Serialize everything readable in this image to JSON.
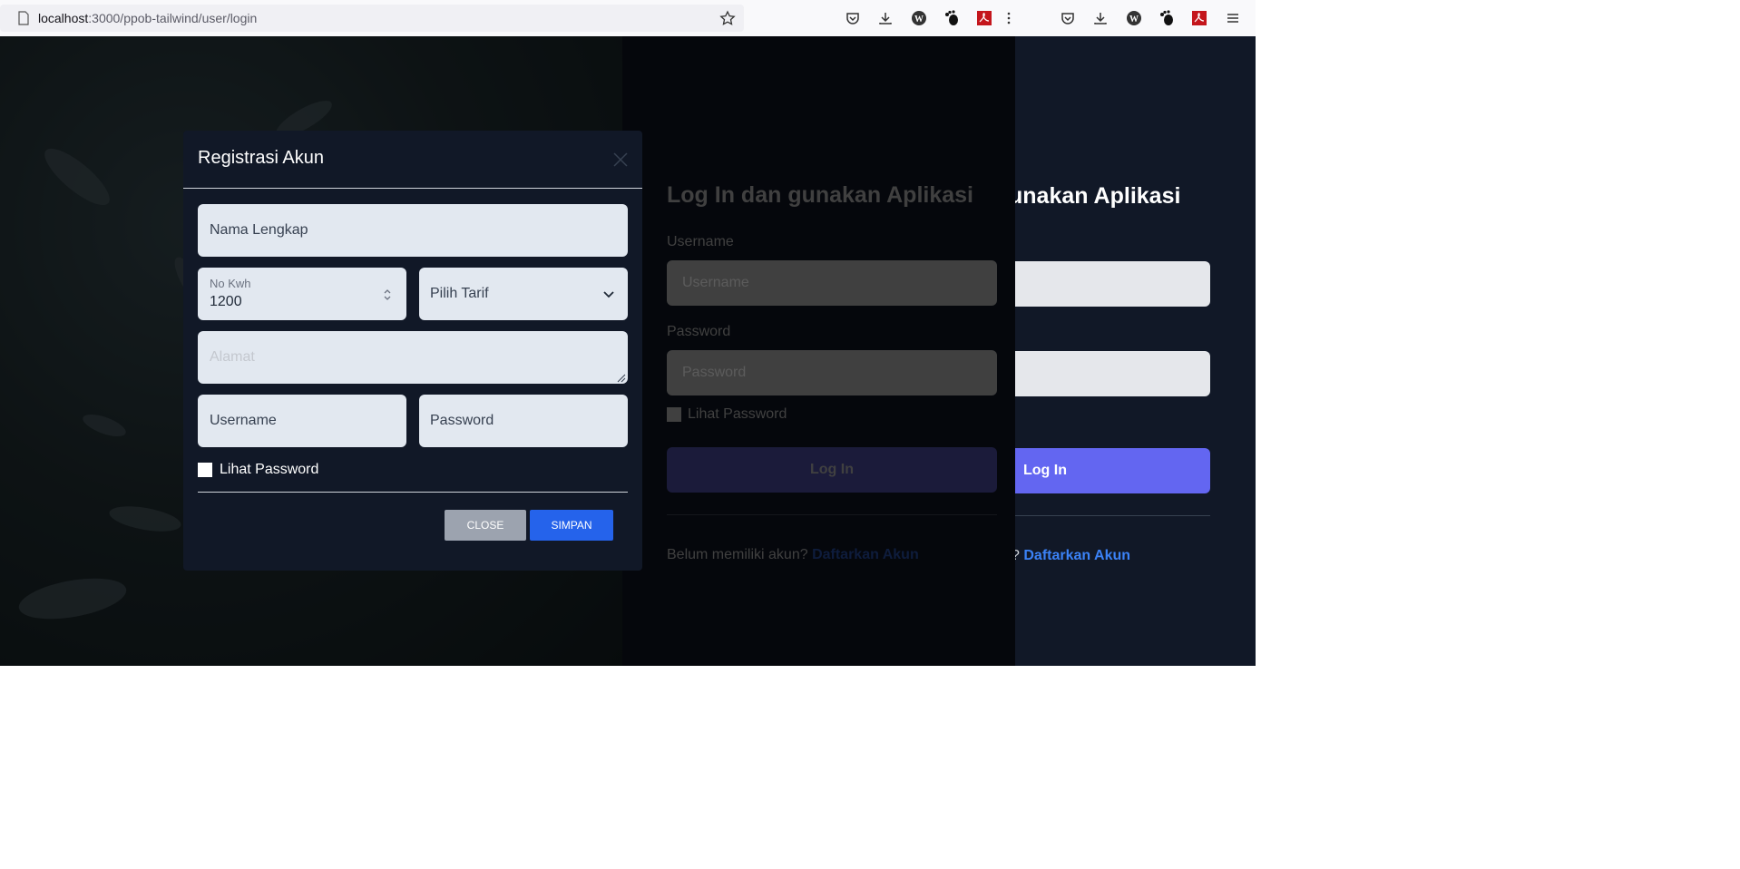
{
  "browser": {
    "url_host": "localhost",
    "url_rest": ":3000/ppob-tailwind/user/login"
  },
  "back_page": {
    "heading_fragment": "unakan Aplikasi",
    "login_label": "Log In",
    "register_prompt_fragment": "?",
    "register_link": "Daftarkan Akun"
  },
  "login": {
    "heading": "Log In dan gunakan Aplikasi",
    "username_label": "Username",
    "username_placeholder": "Username",
    "password_label": "Password",
    "password_placeholder": "Password",
    "show_password_label": "Lihat Password",
    "submit_label": "Log In",
    "register_prompt": "Belum memiliki akun?",
    "register_link": "Daftarkan Akun"
  },
  "modal": {
    "title": "Registrasi Akun",
    "full_name_placeholder": "Nama Lengkap",
    "kwh_label": "No Kwh",
    "kwh_value": "1200",
    "tariff_select": "Pilih Tarif",
    "address_placeholder": "Alamat",
    "username_placeholder": "Username",
    "password_placeholder": "Password",
    "show_password_label": "Lihat Password",
    "close_label": "CLOSE",
    "save_label": "SIMPAN"
  },
  "icons": {
    "page": "page-icon",
    "bookmark": "star-icon",
    "pocket": "pocket-icon",
    "download": "download-icon",
    "wikipedia": "wikipedia-icon",
    "extension": "gnome-foot-icon",
    "pdf": "pdf-icon",
    "overflow": "overflow-icon",
    "menu": "hamburger-menu-icon"
  },
  "colors": {
    "accent": "#6366f1",
    "save": "#2563eb",
    "link": "#3b82f6"
  }
}
